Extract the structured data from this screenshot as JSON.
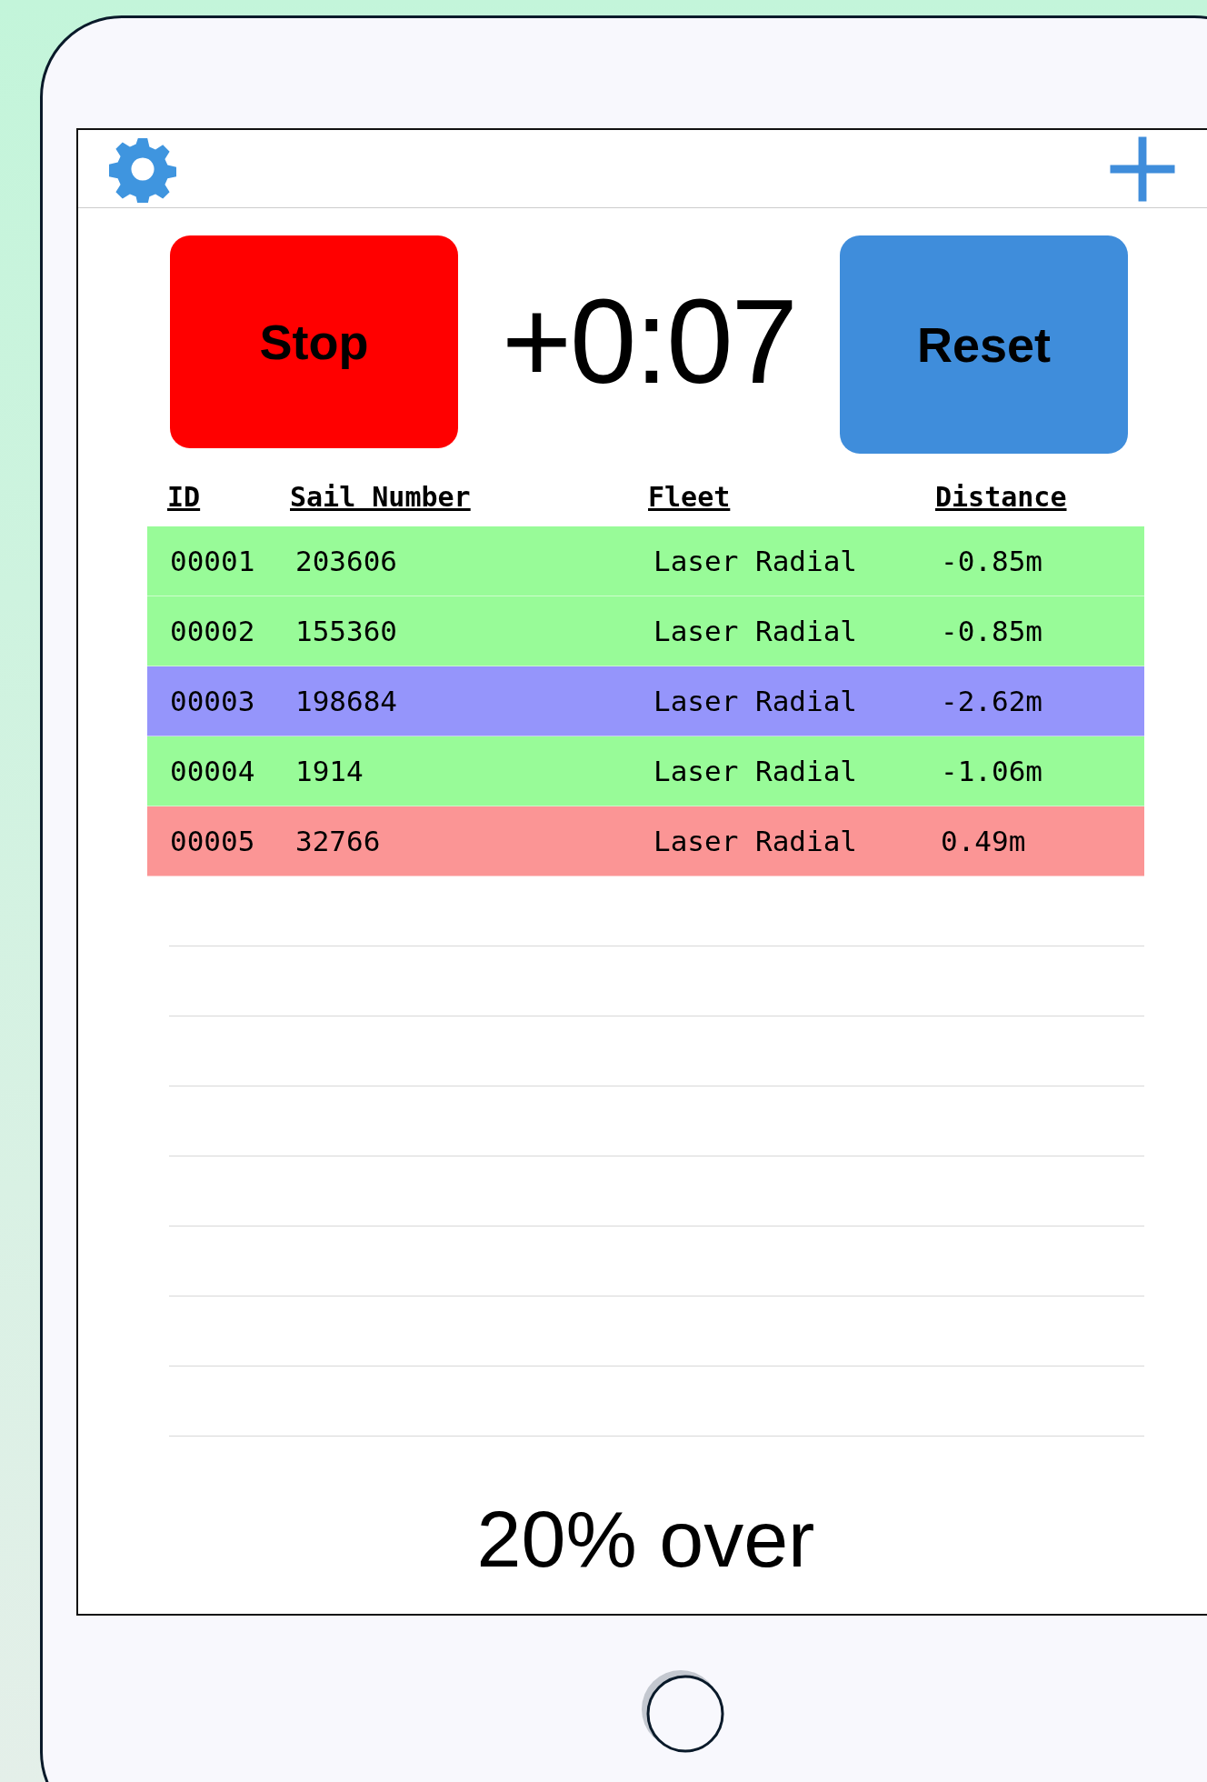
{
  "buttons": [
    {
      "label": "Stop",
      "color": "#ff0000"
    },
    {
      "label": "Reset",
      "color": "#3f8ddb"
    }
  ],
  "timer": "+0:07",
  "table": {
    "columns": [
      "ID",
      "Sail Number",
      "Fleet",
      "Distance"
    ],
    "rows": [
      {
        "id": "00001",
        "sail_number": "203606",
        "fleet": "Laser Radial",
        "distance": "-0.85m",
        "color": "#98fb98"
      },
      {
        "id": "00002",
        "sail_number": "155360",
        "fleet": "Laser Radial",
        "distance": "-0.85m",
        "color": "#98fb98"
      },
      {
        "id": "00003",
        "sail_number": "198684",
        "fleet": "Laser Radial",
        "distance": "-2.62m",
        "color": "#9595fb"
      },
      {
        "id": "00004",
        "sail_number": "1914",
        "fleet": "Laser Radial",
        "distance": "-1.06m",
        "color": "#98fb98"
      },
      {
        "id": "00005",
        "sail_number": "32766",
        "fleet": "Laser Radial",
        "distance": "0.49m",
        "color": "#fb9595"
      }
    ]
  },
  "summary": "20% over"
}
